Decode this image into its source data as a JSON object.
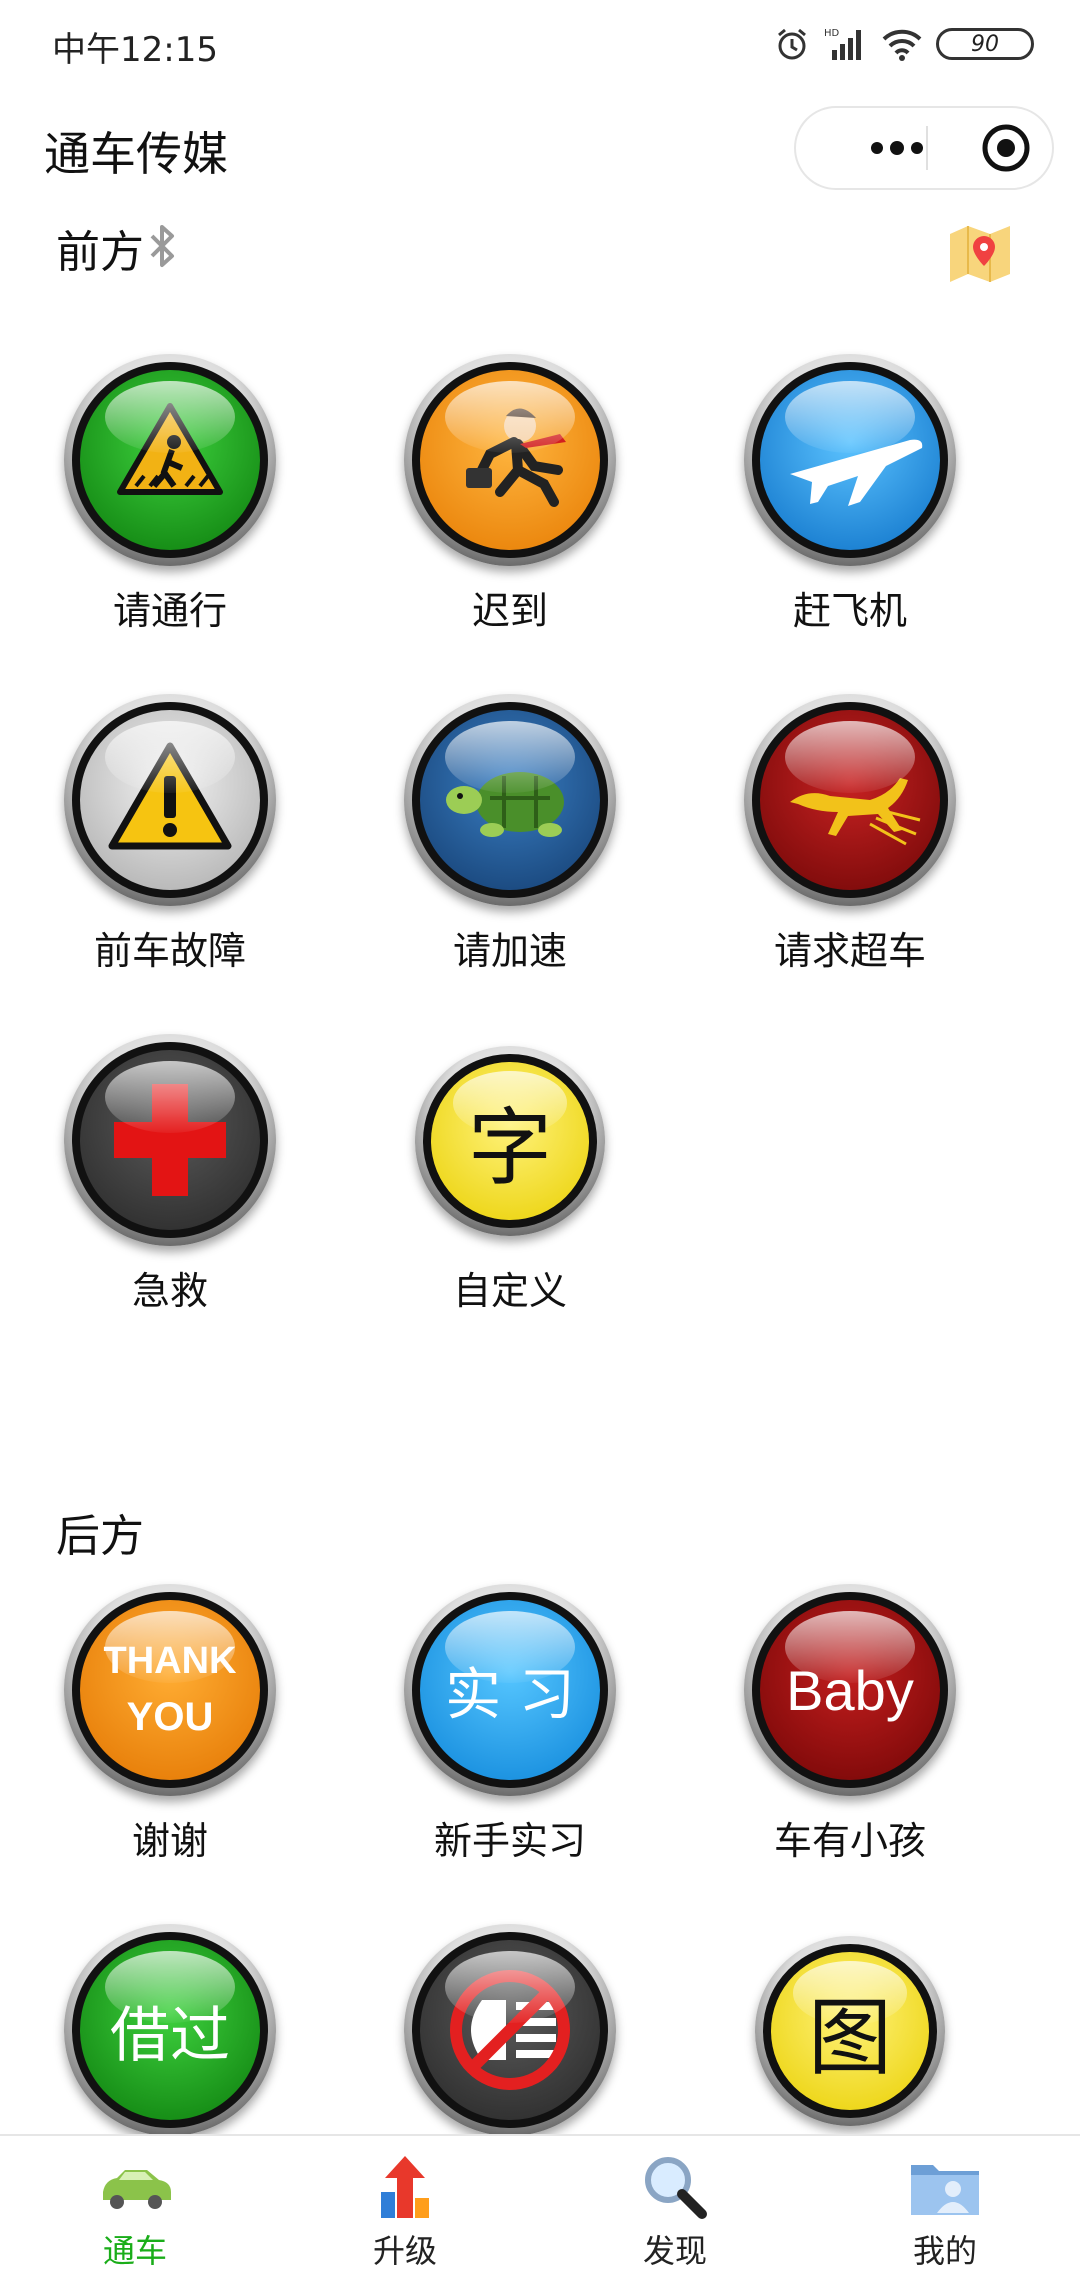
{
  "status_bar": {
    "time": "中午12:15",
    "battery": "90"
  },
  "header": {
    "title": "通车传媒"
  },
  "front": {
    "title": "前方",
    "buttons": [
      {
        "label": "请通行"
      },
      {
        "label": "迟到"
      },
      {
        "label": "赶飞机"
      },
      {
        "label": "前车故障"
      },
      {
        "label": "请加速"
      },
      {
        "label": "请求超车"
      },
      {
        "label": "急救"
      },
      {
        "label": "自定义",
        "glyph": "字"
      }
    ]
  },
  "rear": {
    "title": "后方",
    "buttons": [
      {
        "label": "谢谢",
        "face_text_1": "THANK",
        "face_text_2": "YOU"
      },
      {
        "label": "新手实习",
        "face_text": "实 习"
      },
      {
        "label": "车有小孩",
        "face_text": "Baby"
      },
      {
        "face_text": "借过"
      },
      {},
      {
        "glyph": "图"
      }
    ]
  },
  "tabbar": {
    "items": [
      {
        "label": "通车"
      },
      {
        "label": "升级"
      },
      {
        "label": "发现"
      },
      {
        "label": "我的"
      }
    ]
  },
  "colors": {
    "green": "#1aa31a",
    "orange": "#ff9a12",
    "blue": "#1e90e8",
    "gray": "#cfcfcf",
    "navy": "#1f4f8a",
    "darkred": "#9a0d0d",
    "dark": "#3a3a3a",
    "yellow": "#f4e10a",
    "tab_active": "#1aad19"
  }
}
